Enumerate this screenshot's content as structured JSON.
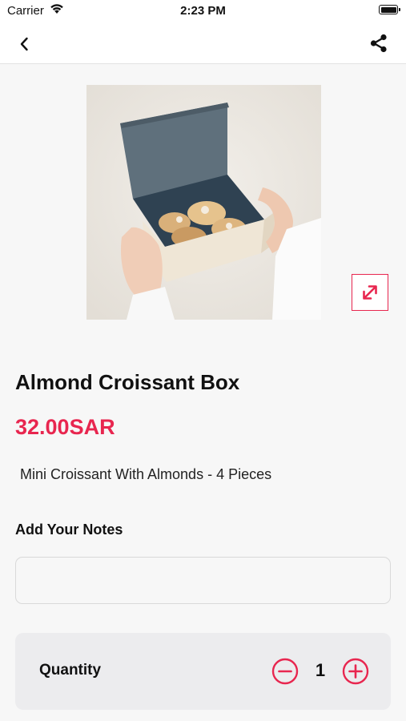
{
  "status_bar": {
    "carrier": "Carrier",
    "time": "2:23 PM"
  },
  "nav": {
    "back_icon": "chevron-left-icon",
    "share_icon": "share-icon"
  },
  "product": {
    "image_alt": "Box of almond croissants held in hands",
    "expand_icon": "expand-icon",
    "title": "Almond Croissant Box",
    "price": "32.00SAR",
    "description": "Mini Croissant With Almonds - 4 Pieces"
  },
  "notes": {
    "label": "Add Your Notes",
    "value": "",
    "placeholder": ""
  },
  "quantity": {
    "label": "Quantity",
    "value": "1",
    "minus_icon": "minus-circle-icon",
    "plus_icon": "plus-circle-icon"
  },
  "colors": {
    "accent": "#e8264f",
    "background": "#f7f7f7",
    "card": "#ececee"
  }
}
